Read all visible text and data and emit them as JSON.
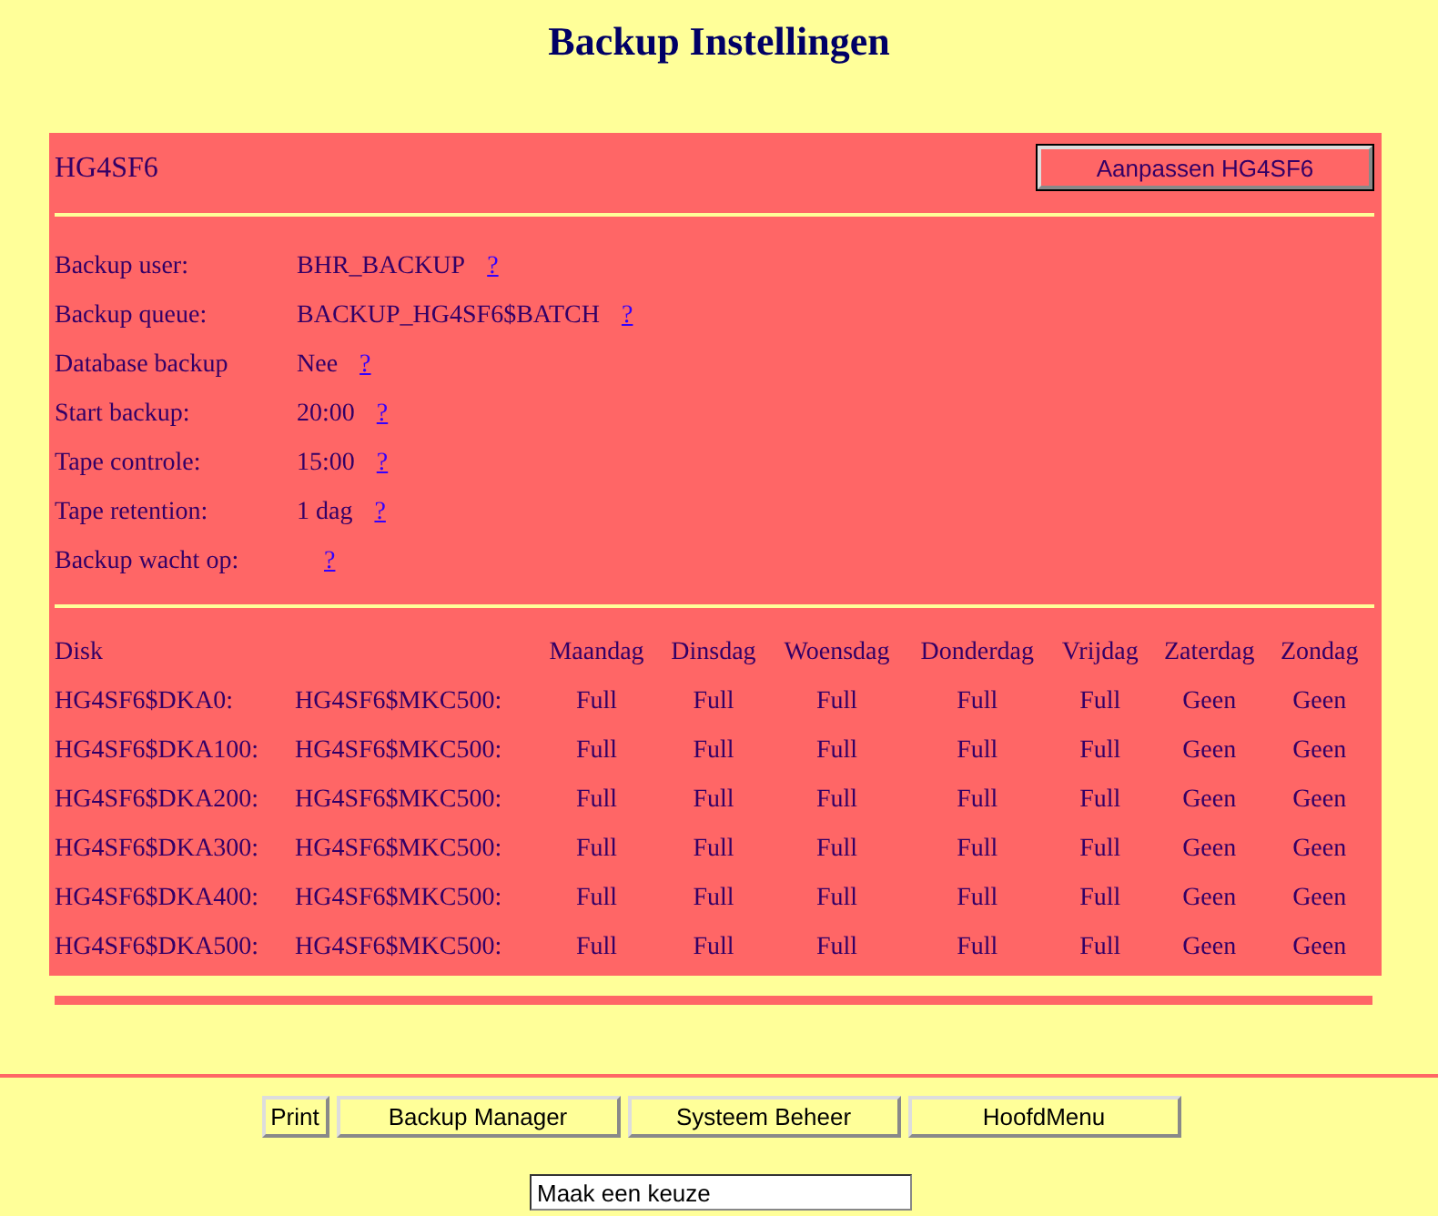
{
  "title": "Backup Instellingen",
  "node": {
    "name": "HG4SF6",
    "edit_button": "Aanpassen HG4SF6"
  },
  "settings": [
    {
      "label": "Backup user:",
      "value": "BHR_BACKUP",
      "help": "?"
    },
    {
      "label": "Backup queue:",
      "value": "BACKUP_HG4SF6$BATCH",
      "help": "?"
    },
    {
      "label": "Database backup",
      "value": "Nee",
      "help": "?"
    },
    {
      "label": "Start backup:",
      "value": "20:00",
      "help": "?"
    },
    {
      "label": "Tape controle:",
      "value": "15:00",
      "help": "?"
    },
    {
      "label": "Tape retention:",
      "value": "1 dag",
      "help": "?"
    },
    {
      "label": "Backup wacht op:",
      "help": "?"
    }
  ],
  "table": {
    "columns": [
      "Disk",
      null,
      "Maandag",
      "Dinsdag",
      "Woensdag",
      "Donderdag",
      "Vrijdag",
      "Zaterdag",
      "Zondag"
    ],
    "rows": [
      [
        "HG4SF6$DKA0:",
        "HG4SF6$MKC500:",
        "Full",
        "Full",
        "Full",
        "Full",
        "Full",
        "Geen",
        "Geen"
      ],
      [
        "HG4SF6$DKA100:",
        "HG4SF6$MKC500:",
        "Full",
        "Full",
        "Full",
        "Full",
        "Full",
        "Geen",
        "Geen"
      ],
      [
        "HG4SF6$DKA200:",
        "HG4SF6$MKC500:",
        "Full",
        "Full",
        "Full",
        "Full",
        "Full",
        "Geen",
        "Geen"
      ],
      [
        "HG4SF6$DKA300:",
        "HG4SF6$MKC500:",
        "Full",
        "Full",
        "Full",
        "Full",
        "Full",
        "Geen",
        "Geen"
      ],
      [
        "HG4SF6$DKA400:",
        "HG4SF6$MKC500:",
        "Full",
        "Full",
        "Full",
        "Full",
        "Full",
        "Geen",
        "Geen"
      ],
      [
        "HG4SF6$DKA500:",
        "HG4SF6$MKC500:",
        "Full",
        "Full",
        "Full",
        "Full",
        "Full",
        "Geen",
        "Geen"
      ]
    ]
  },
  "buttons": [
    "Print",
    "Backup Manager",
    "Systeem Beheer",
    "HoofdMenu"
  ],
  "choice_field": {
    "value": "Maak een keuze"
  }
}
